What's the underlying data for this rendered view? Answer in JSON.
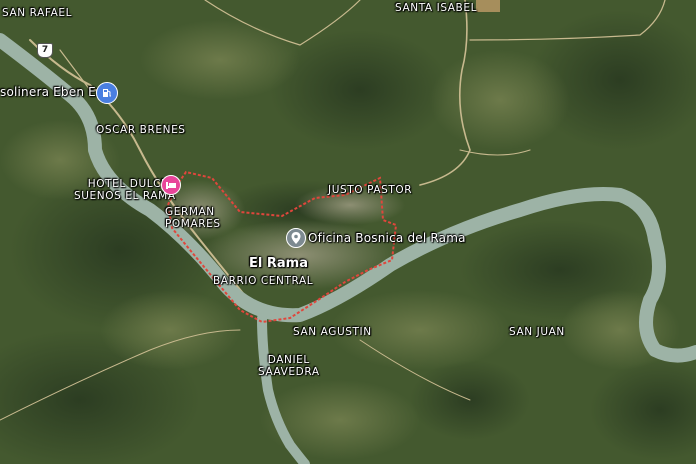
{
  "labels": {
    "san_rafael": "SAN RAFAEL",
    "santa_isabel": "SANTA ISABEL",
    "route_number": "7",
    "gas_station": "solinera Eben Ezer",
    "oscar_brenes": "OSCAR BRENES",
    "hotel_line1": "HOTEL DULCES",
    "hotel_line2": "SUENOS EL RAMA",
    "german_line1": "GERMAN",
    "german_line2": "POMARES",
    "justo_pastor": "JUSTO PASTOR",
    "oficina": "Oficina Bosnica del Rama",
    "el_rama": "El Rama",
    "barrio_central": "BARRIO CENTRAL",
    "san_agustin": "SAN AGUSTIN",
    "daniel_line1": "DANIEL",
    "daniel_line2": "SAAVEDRA",
    "san_juan": "SAN JUAN"
  },
  "icons": {
    "gas_station": "gas-station-icon",
    "hotel": "hotel-bed-icon",
    "place": "location-pin-icon"
  },
  "colors": {
    "river": "#9db3a6",
    "boundary": "#e0463c",
    "gas_pin": "#4a7fe0",
    "hotel_pin": "#e8459a",
    "place_pin": "#7d8a91"
  }
}
